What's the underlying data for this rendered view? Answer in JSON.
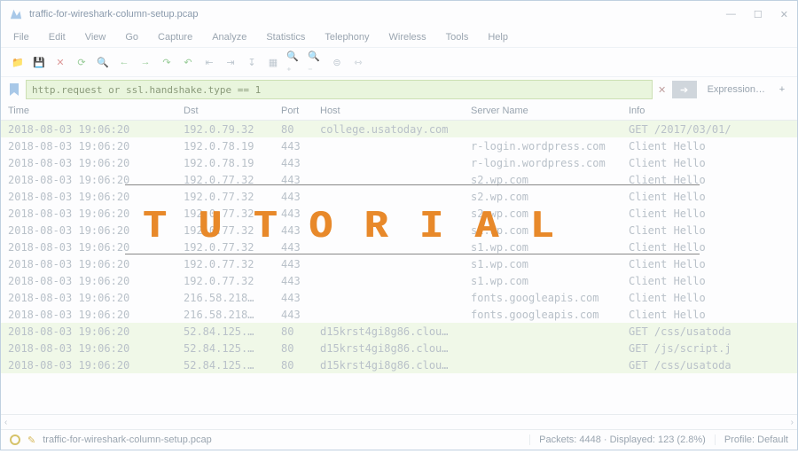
{
  "title": "traffic-for-wireshark-column-setup.pcap",
  "window_buttons": {
    "min": "—",
    "max": "☐",
    "close": "✕"
  },
  "menu": [
    "File",
    "Edit",
    "View",
    "Go",
    "Capture",
    "Analyze",
    "Statistics",
    "Telephony",
    "Wireless",
    "Tools",
    "Help"
  ],
  "filter": "http.request or ssl.handshake.type == 1",
  "expression_label": "Expression…",
  "columns": {
    "time": "Time",
    "dst": "Dst",
    "port": "Port",
    "host": "Host",
    "server": "Server Name",
    "info": "Info"
  },
  "rows": [
    {
      "g": true,
      "time": "2018-08-03 19:06:20",
      "dst": "192.0.79.32",
      "port": "80",
      "host": "college.usatoday.com",
      "server": "",
      "info": "GET /2017/03/01/"
    },
    {
      "g": false,
      "time": "2018-08-03 19:06:20",
      "dst": "192.0.78.19",
      "port": "443",
      "host": "",
      "server": "r-login.wordpress.com",
      "info": "Client Hello"
    },
    {
      "g": false,
      "time": "2018-08-03 19:06:20",
      "dst": "192.0.78.19",
      "port": "443",
      "host": "",
      "server": "r-login.wordpress.com",
      "info": "Client Hello"
    },
    {
      "g": false,
      "time": "2018-08-03 19:06:20",
      "dst": "192.0.77.32",
      "port": "443",
      "host": "",
      "server": "s2.wp.com",
      "info": "Client Hello"
    },
    {
      "g": false,
      "time": "2018-08-03 19:06:20",
      "dst": "192.0.77.32",
      "port": "443",
      "host": "",
      "server": "s2.wp.com",
      "info": "Client Hello"
    },
    {
      "g": false,
      "time": "2018-08-03 19:06:20",
      "dst": "192.0.77.32",
      "port": "443",
      "host": "",
      "server": "s2.wp.com",
      "info": "Client Hello"
    },
    {
      "g": false,
      "time": "2018-08-03 19:06:20",
      "dst": "192.0.77.32",
      "port": "443",
      "host": "",
      "server": "s2.wp.com",
      "info": "Client Hello"
    },
    {
      "g": false,
      "time": "2018-08-03 19:06:20",
      "dst": "192.0.77.32",
      "port": "443",
      "host": "",
      "server": "s1.wp.com",
      "info": "Client Hello"
    },
    {
      "g": false,
      "time": "2018-08-03 19:06:20",
      "dst": "192.0.77.32",
      "port": "443",
      "host": "",
      "server": "s1.wp.com",
      "info": "Client Hello"
    },
    {
      "g": false,
      "time": "2018-08-03 19:06:20",
      "dst": "192.0.77.32",
      "port": "443",
      "host": "",
      "server": "s1.wp.com",
      "info": "Client Hello"
    },
    {
      "g": false,
      "time": "2018-08-03 19:06:20",
      "dst": "216.58.218…",
      "port": "443",
      "host": "",
      "server": "fonts.googleapis.com",
      "info": "Client Hello"
    },
    {
      "g": false,
      "time": "2018-08-03 19:06:20",
      "dst": "216.58.218…",
      "port": "443",
      "host": "",
      "server": "fonts.googleapis.com",
      "info": "Client Hello"
    },
    {
      "g": true,
      "time": "2018-08-03 19:06:20",
      "dst": "52.84.125.…",
      "port": "80",
      "host": "d15krst4gi8g86.clou…",
      "server": "",
      "info": "GET /css/usatoda"
    },
    {
      "g": true,
      "time": "2018-08-03 19:06:20",
      "dst": "52.84.125.…",
      "port": "80",
      "host": "d15krst4gi8g86.clou…",
      "server": "",
      "info": "GET /js/script.j"
    },
    {
      "g": true,
      "time": "2018-08-03 19:06:20",
      "dst": "52.84.125.…",
      "port": "80",
      "host": "d15krst4gi8g86.clou…",
      "server": "",
      "info": "GET /css/usatoda"
    }
  ],
  "status_file": "traffic-for-wireshark-column-setup.pcap",
  "status_packets": "Packets: 4448 · Displayed: 123 (2.8%)",
  "status_profile": "Profile: Default",
  "overlay": "TUTORIAL"
}
